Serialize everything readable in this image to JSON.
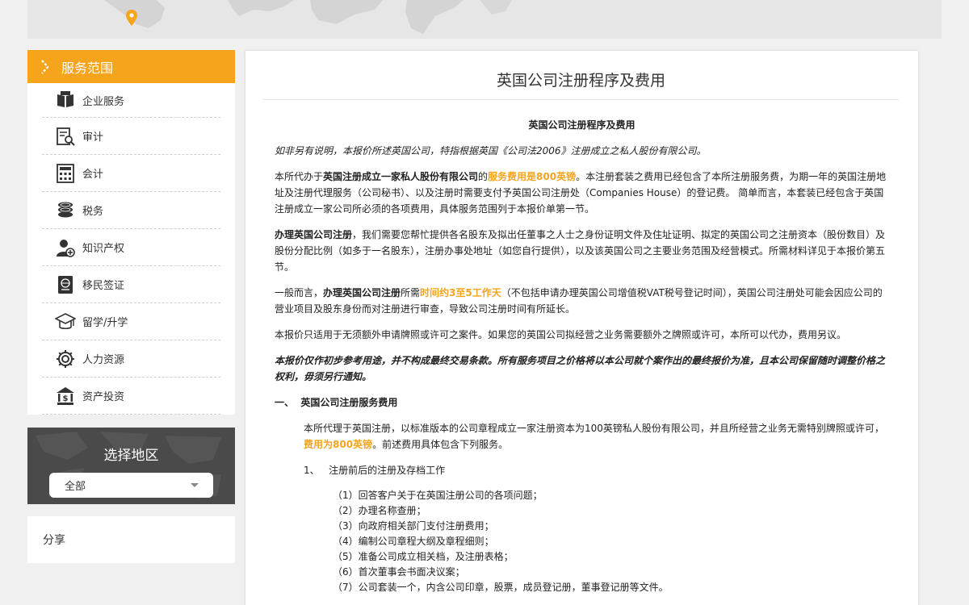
{
  "sidebar": {
    "header": "服务范围",
    "items": [
      {
        "label": "企业服务",
        "icon": "book-icon"
      },
      {
        "label": "审计",
        "icon": "audit-report-icon"
      },
      {
        "label": "会计",
        "icon": "calculator-icon"
      },
      {
        "label": "税务",
        "icon": "coins-icon"
      },
      {
        "label": "知识产权",
        "icon": "user-plus-icon"
      },
      {
        "label": "移民签证",
        "icon": "passport-icon"
      },
      {
        "label": "留学/升学",
        "icon": "graduation-cap-icon"
      },
      {
        "label": "人力资源",
        "icon": "gear-icon"
      },
      {
        "label": "资产投资",
        "icon": "bank-dollar-icon"
      }
    ]
  },
  "region": {
    "title": "选择地区",
    "selected": "全部"
  },
  "share": {
    "label": "分享"
  },
  "main": {
    "title": "英国公司注册程序及费用",
    "subtitle": "英国公司注册程序及费用",
    "intro_italic": "如非另有说明，本报价所述英国公司，特指根据英国《公司法2006》注册成立之私人股份有限公司。",
    "p1": {
      "a": "本所代办于",
      "b": "英国注册成立一家私人股份有限公司",
      "c": "的",
      "d": "服务费用是800英镑",
      "e": "。本注册套装之费用已经包含了本所注册服务费，为期一年的英国注册地址及注册代理服务（公司秘书）、以及注册时需要支付予英国公司注册处（Companies House）的登记费。 简单而言，本套装已经包含于英国注册成立一家公司所必须的各项费用，具体服务范围列于本报价单第一节。"
    },
    "p2": {
      "a": "办理英国公司注册",
      "b": "，我们需要您帮忙提供各名股东及拟出任董事之人士之身份证明文件及住址证明、拟定的英国公司之注册资本（股份数目）及股份分配比例（如多于一名股东），注册办事处地址（如您自行提供），以及该英国公司之主要业务范围及经营模式。所需材料详见于本报价第五节。"
    },
    "p3": {
      "a": "一般而言，",
      "b": "办理英国公司注册",
      "c": "所需",
      "d": "时间约3至5工作天",
      "e": "（不包括申请办理英国公司增值税VAT税号登记时间），英国公司注册处可能会因应公司的营业项目及股东身份而对注册进行审查，导致公司注册时间有所延长。"
    },
    "p4": "本报价只适用于无须额外申请牌照或许可之案件。如果您的英国公司拟经营之业务需要额外之牌照或许可，本所可以代办，费用另议。",
    "p5": "本报价仅作初步参考用途，并不构成最终交易条款。所有服务项目之价格将以本公司就个案作出的最终报价为准，且本公司保留随时调整价格之权利，毋须另行通知。",
    "section1": {
      "heading": "一、  英国公司注册服务费用",
      "para_a": "本所代理于英国注册，以标准版本的公司章程成立一家注册资本为100英镑私人股份有限公司，并且所经营之业务无需特别牌照或许可，",
      "para_b": "费用为800英镑",
      "para_c": "。前述费用具体包含下列服务。",
      "sub1": "1、   注册前后的注册及存档工作",
      "items": [
        "（1）回答客户关于在英国注册公司的各项问题；",
        "（2）办理名称查册；",
        "（3）向政府相关部门支付注册费用；",
        "（4）编制公司章程大纲及章程细则；",
        "（5）准备公司成立相关档，及注册表格；",
        "（6）首次董事会书面决议案；",
        "（7）公司套装一个，内含公司印章，股票，成员登记册，董事登记册等文件。"
      ]
    }
  },
  "colors": {
    "accent": "#f6a41c",
    "region_bg": "#4a4a4a"
  }
}
